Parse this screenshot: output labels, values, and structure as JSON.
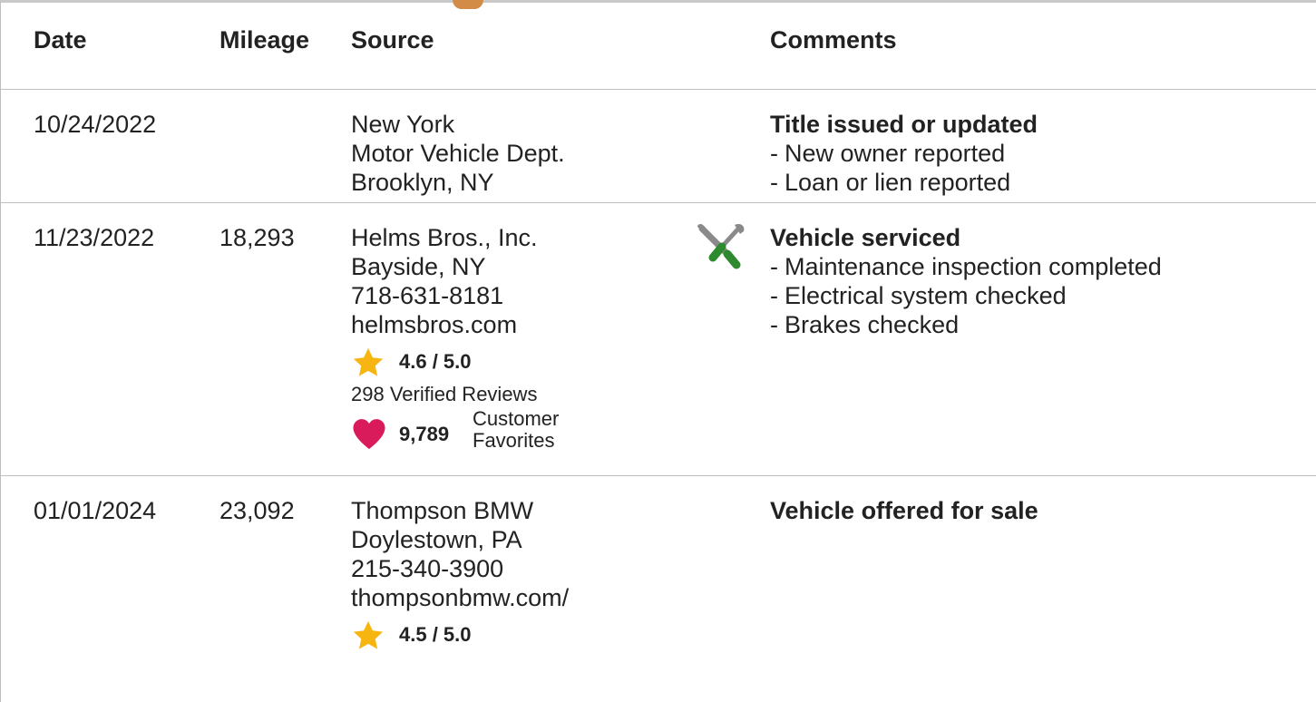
{
  "header": {
    "date": "Date",
    "mileage": "Mileage",
    "source": "Source",
    "comments": "Comments"
  },
  "records": [
    {
      "date": "10/24/2022",
      "mileage": "",
      "source": [
        "New York",
        "Motor Vehicle Dept.",
        "Brooklyn, NY"
      ],
      "comment_title": "Title issued or updated",
      "comment_items": [
        "New owner reported",
        "Loan or lien reported"
      ]
    },
    {
      "date": "11/23/2022",
      "mileage": "18,293",
      "source": [
        "Helms Bros., Inc.",
        "Bayside, NY",
        "718-631-8181",
        "helmsbros.com"
      ],
      "rating": "4.6 / 5.0",
      "reviews": "298 Verified Reviews",
      "favorites_count": "9,789",
      "favorites_label": [
        "Customer",
        "Favorites"
      ],
      "icon": "service-wrench-screwdriver-icon",
      "comment_title": "Vehicle serviced",
      "comment_items": [
        "Maintenance inspection completed",
        "Electrical system checked",
        "Brakes checked"
      ]
    },
    {
      "date": "01/01/2024",
      "mileage": "23,092",
      "source": [
        "Thompson BMW",
        "Doylestown, PA",
        "215-340-3900",
        "thompsonbmw.com/"
      ],
      "rating": "4.5 / 5.0",
      "comment_title": "Vehicle offered for sale",
      "comment_items": []
    }
  ],
  "bullet_marker": "-",
  "colors": {
    "star": "#f6b511",
    "heart": "#d91b5c",
    "screwdriver_handle": "#2e8a2e",
    "tool_metal": "#8a8a8a",
    "row_divider": "#bfbfbf"
  }
}
